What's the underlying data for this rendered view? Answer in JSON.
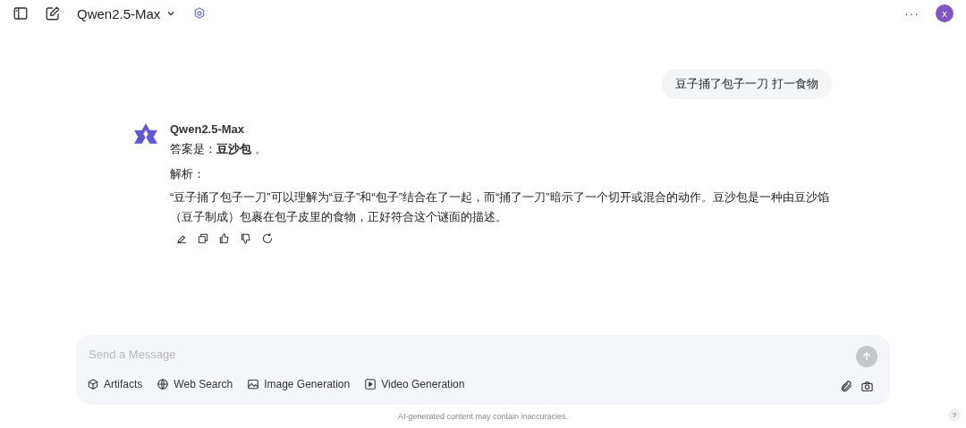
{
  "header": {
    "model": "Qwen2.5-Max",
    "avatar_initial": "x",
    "more": "···"
  },
  "user_message": "豆子捅了包子一刀 打一食物",
  "assistant": {
    "name": "Qwen2.5-Max",
    "answer": "答案是：**豆沙包** 。",
    "analysis_label": "解析：",
    "analysis": "“豆子捅了包子一刀”可以理解为“豆子”和“包子”结合在了一起，而“捅了一刀”暗示了一个切开或混合的动作。豆沙包是一种由豆沙馅（豆子制成）包裹在包子皮里的食物，正好符合这个谜面的描述。"
  },
  "composer": {
    "placeholder": "Send a Message",
    "tools": [
      {
        "kind": "artifacts",
        "label": "Artifacts"
      },
      {
        "kind": "web",
        "label": "Web Search"
      },
      {
        "kind": "image",
        "label": "Image Generation"
      },
      {
        "kind": "video",
        "label": "Video Generation"
      }
    ]
  },
  "disclaimer": "AI-generated content may contain inaccuracies.",
  "help": "?"
}
